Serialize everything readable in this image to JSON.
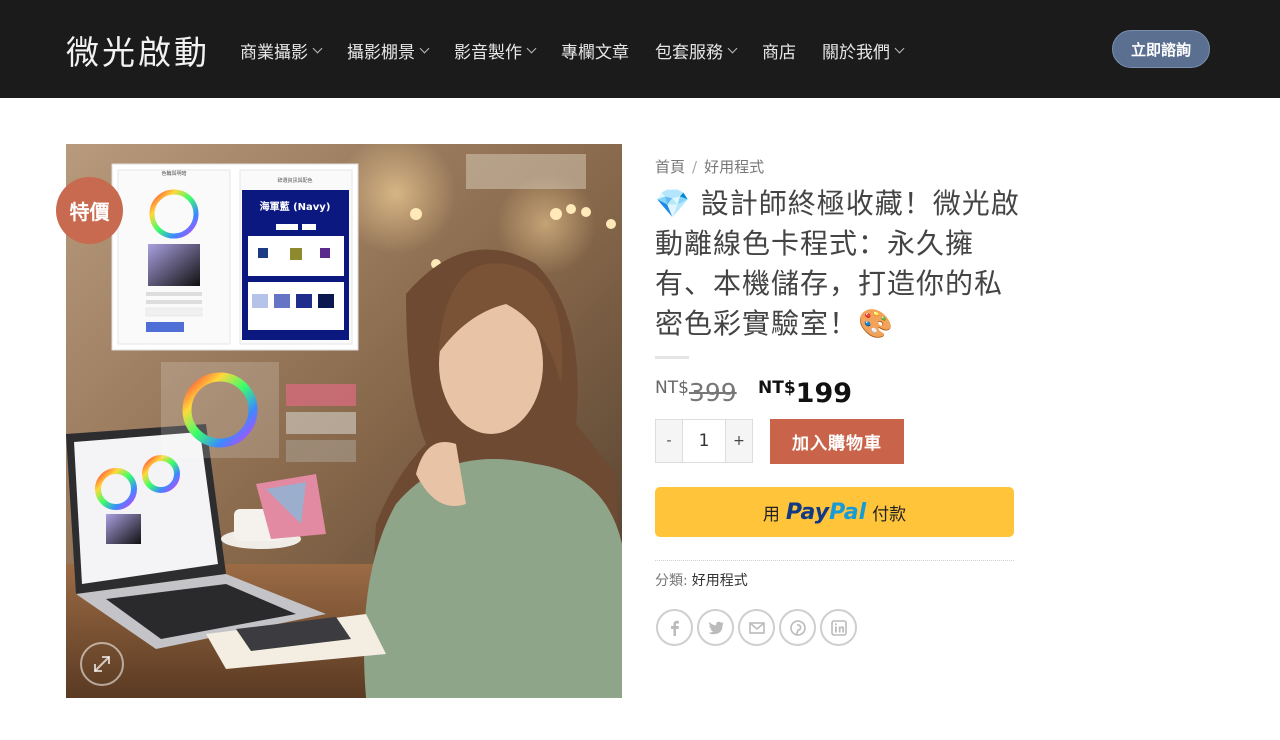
{
  "header": {
    "logo": "微光啟動",
    "nav": [
      {
        "label": "商業攝影",
        "has_dropdown": true
      },
      {
        "label": "攝影棚景",
        "has_dropdown": true
      },
      {
        "label": "影音製作",
        "has_dropdown": true
      },
      {
        "label": "專欄文章",
        "has_dropdown": false
      },
      {
        "label": "包套服務",
        "has_dropdown": true
      },
      {
        "label": "商店",
        "has_dropdown": false
      },
      {
        "label": "關於我們",
        "has_dropdown": true
      }
    ],
    "cta_label": "立即諮詢"
  },
  "product": {
    "sale_badge": "特價",
    "breadcrumb": {
      "home": "首頁",
      "sep": "/",
      "category": "好用程式"
    },
    "title": "💎 設計師終極收藏！微光啟動離線色卡程式：永久擁有、本機儲存，打造你的私密色彩實驗室！🎨",
    "price_old": {
      "currency": "NT$",
      "amount": "399"
    },
    "price_new": {
      "currency": "NT$",
      "amount": "199"
    },
    "quantity": {
      "minus": "-",
      "value": "1",
      "plus": "+"
    },
    "add_to_cart": "加入購物車",
    "paypal": {
      "prefix": "用",
      "brand_a": "Pay",
      "brand_b": "Pal",
      "suffix": "付款"
    },
    "category_label": "分類:",
    "category_value": "好用程式",
    "image_text": {
      "panel_left_title": "色輪與明暗",
      "panel_right_title": "辞選資訊與配色",
      "swatch_title": "海軍藍 (Navy)"
    }
  },
  "colors": {
    "header_bg": "#1b1b1b",
    "accent": "#c9644a",
    "cta": "#5b7091",
    "paypal": "#ffc43a"
  },
  "share_icons": [
    "facebook-icon",
    "twitter-icon",
    "email-icon",
    "pinterest-icon",
    "linkedin-icon"
  ]
}
